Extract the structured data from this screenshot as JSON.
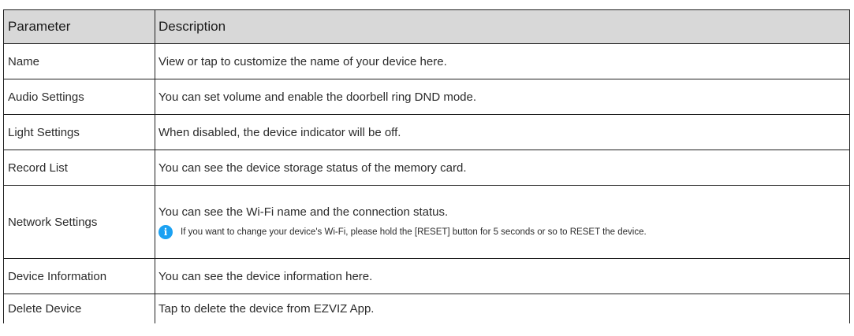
{
  "table": {
    "header": {
      "parameter": "Parameter",
      "description": "Description"
    },
    "rows": [
      {
        "parameter": "Name",
        "description": "View or tap to customize the name of your device here."
      },
      {
        "parameter": "Audio Settings",
        "description": "You can set volume and enable the doorbell ring DND mode."
      },
      {
        "parameter": "Light Settings",
        "description": "When disabled, the device indicator will be off."
      },
      {
        "parameter": "Record List",
        "description": "You can see the device storage status of the memory card."
      },
      {
        "parameter": "Network Settings",
        "description": "You can see the Wi-Fi name and the connection status.",
        "note": "If you want to change your device's Wi-Fi, please hold the [RESET] button for 5 seconds or so to RESET the device.",
        "note_icon": "info-icon",
        "note_icon_glyph": "i"
      },
      {
        "parameter": "Device Information",
        "description": "You can see the device information here."
      },
      {
        "parameter": "Delete Device",
        "description": "Tap to delete the device from EZVIZ App."
      }
    ]
  },
  "colors": {
    "header_bg": "#d8d8d8",
    "border": "#1f1f1f",
    "info_icon": "#1ba1f2"
  }
}
